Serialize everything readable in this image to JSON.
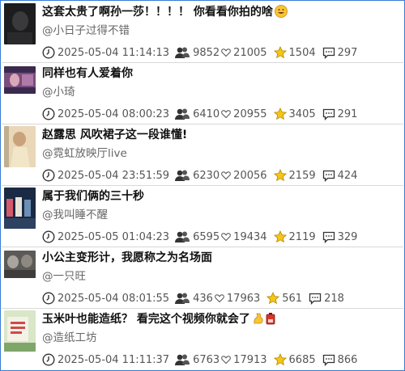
{
  "items": [
    {
      "title": "这套太贵了啊孙一莎！！！！ 你看看你拍的啥",
      "title_emoji": "grin-emoji",
      "author": "@小日子过得不错",
      "date": "2025-05-04 11:14:13",
      "views": "9852",
      "likes": "21005",
      "favorites": "1504",
      "comments": "297",
      "thumb_colors": [
        "#1d1d1f",
        "#3a3a3c"
      ]
    },
    {
      "title": "同样也有人爱着你",
      "author": "@小琦",
      "date": "2025-05-04 08:00:23",
      "views": "6410",
      "likes": "20955",
      "favorites": "3405",
      "comments": "291",
      "thumb_colors": [
        "#3b2a4f",
        "#b07aa8"
      ]
    },
    {
      "title": "赵露思 风吹裙子这一段谁懂!",
      "author": "@霓虹放映厅live",
      "date": "2025-05-04 23:51:59",
      "views": "6230",
      "likes": "20056",
      "favorites": "2159",
      "comments": "424",
      "thumb_colors": [
        "#e9d7b8",
        "#c9a27c"
      ]
    },
    {
      "title": "属于我们俩的三十秒",
      "author": "@我叫睡不醒",
      "date": "2025-05-05 01:04:23",
      "views": "6595",
      "likes": "19434",
      "favorites": "2119",
      "comments": "329",
      "thumb_colors": [
        "#1b2a44",
        "#6c8fb4"
      ]
    },
    {
      "title": "小公主变形计，我愿称之为名场面",
      "author": "@一只旺",
      "date": "2025-05-04 08:01:55",
      "views": "436",
      "likes": "17963",
      "favorites": "561",
      "comments": "218",
      "thumb_colors": [
        "#5c5a57",
        "#a9a59e"
      ]
    },
    {
      "title": "玉米叶也能造纸？ 看完这个视频你就会了",
      "title_emoji": "muscle-emoji",
      "title_emoji2": "battery-emoji",
      "author": "@造纸工坊",
      "date": "2025-05-04 11:11:37",
      "views": "6763",
      "likes": "17913",
      "favorites": "6685",
      "comments": "866",
      "thumb_colors": [
        "#d9e6c8",
        "#7fa66a"
      ]
    }
  ],
  "colors": {
    "border": "#3a7bd5",
    "star": "#f5c518",
    "text": "#111111",
    "muted": "#666666"
  }
}
